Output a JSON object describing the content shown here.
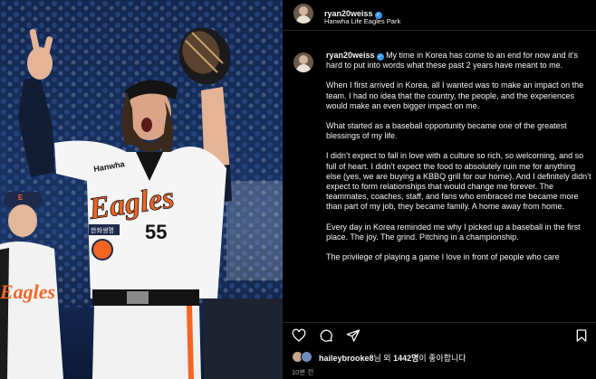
{
  "post": {
    "username": "ryan20weiss",
    "location": "Hanwha Life Eagles Park",
    "caption_username": "ryan20weiss",
    "caption_paragraphs": [
      "My time in Korea has come to an end for now and it’s hard to put into words what these past 2 years have meant to me.",
      "When I first arrived in Korea, all I wanted was to make an impact on the team. I had no idea that the country, the people, and the experiences would make an even bigger impact on me.",
      "What started as a baseball opportunity became one of the greatest blessings of my life.",
      "I didn’t expect to fall in love with a culture so rich, so welcoming, and so full of heart. I didn’t expect the food to absolutely ruin me for anything else (yes, we are buying a KBBQ grill for our home). And I definitely didn’t expect to form relationships that would change me forever. The teammates, coaches, staff, and fans who embraced me became more than part of my job, they became family. A home away from home.",
      "Every day in Korea reminded me why I picked up a baseball in the first place. The joy. The grind. Pitching in a championship.",
      "The privilege of playing a game I love in front of people who care"
    ],
    "likes_user": "haileybrooke8",
    "likes_suffix": "님 외 ",
    "likes_count": "1442명",
    "likes_tail": "이 좋아합니다",
    "time_ago": "10분 전"
  },
  "photo": {
    "jersey_team": "Eagles",
    "jersey_number": "55",
    "chest_patch": "Hanwha",
    "sleeve_patch": "한화생명",
    "bg_player_team": "Eagles"
  },
  "icons": [
    "verified-icon",
    "heart-icon",
    "comment-icon",
    "share-icon",
    "bookmark-icon"
  ],
  "colors": {
    "accent": "#3897f0",
    "eagles_orange": "#f26522",
    "panel_bg": "#000000"
  }
}
